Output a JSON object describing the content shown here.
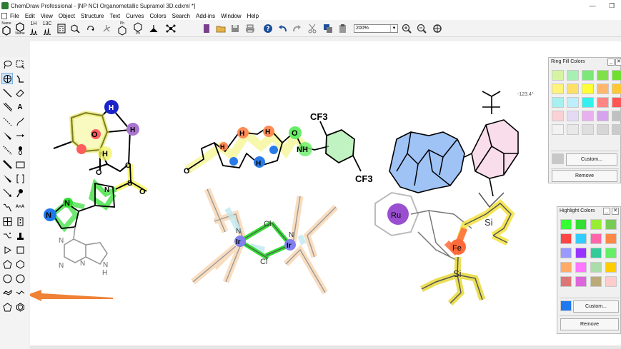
{
  "window": {
    "title": "ChemDraw Professional - [NP NCI Organometallic Supramol 3D.cdxml *]",
    "minimize_glyph": "—",
    "maximize_glyph": "❐"
  },
  "menu": [
    "File",
    "Edit",
    "View",
    "Object",
    "Structure",
    "Text",
    "Curves",
    "Colors",
    "Search",
    "Add-ins",
    "Window",
    "Help"
  ],
  "toolbar": {
    "structure_to_name_label": "Name",
    "name_to_structure_label": "Name",
    "c13_label": "13C",
    "h1_label": "1H",
    "ph_label_1": "Ph",
    "ph_label_2": "Ph",
    "zoom_value": "200%"
  },
  "tools": {
    "text_tool_label": "A",
    "style_label": "A+A"
  },
  "canvas": {
    "angle_readout": "-123.4°",
    "atom_labels": {
      "cf3_top": "CF3",
      "cf3_bottom": "CF3",
      "nh": "NH",
      "o_imide": "O",
      "o_amide": "O",
      "o_ketone": "O",
      "o_ring": "O",
      "o_sulfone_1": "O",
      "o_sulfone_2": "O",
      "s": "S",
      "n_azet": "N",
      "n_pyrazole_1": "N",
      "n_pyrazole_2": "N",
      "n_pyr_1": "N",
      "n_pyr_2": "N",
      "n_pyr_3": "N",
      "nh_pyrrole": "H",
      "n_pyrrole": "N",
      "h1": "H",
      "h2": "H",
      "h3": "H",
      "h4": "H",
      "h5": "H",
      "h6": "H",
      "h7": "H",
      "ir_1": "Ir",
      "ir_2": "Ir",
      "cl_1": "Cl",
      "cl_2": "Cl",
      "n_ir1": "N",
      "n_ir2": "N",
      "ru": "Ru",
      "fe": "Fe",
      "si_1": "Si",
      "si_2": "Si"
    }
  },
  "ring_fill_palette": {
    "title": "Ring Fill Colors",
    "colors": [
      "#d6f5a3",
      "#a8efb3",
      "#7de87a",
      "#7fe04a",
      "#6fe032",
      "#fff37a",
      "#ffe066",
      "#ffff33",
      "#ffb86b",
      "#ffc833",
      "#a6f1ef",
      "#bdeefb",
      "#33f0ee",
      "#ff8585",
      "#ff5555",
      "#fbd1d6",
      "#e5daf5",
      "#e8b0ef",
      "#d6a3ef",
      "#c0c0c0",
      "#f2f2f2",
      "#e8e8e8",
      "#dedede",
      "#d6d6d6",
      "#cbcbcb"
    ],
    "custom_swatch": "#c8c8c8",
    "custom_label": "Custom...",
    "remove_label": "Remove"
  },
  "highlight_palette": {
    "title": "Highlight Colors",
    "colors": [
      "#33ff33",
      "#33dd33",
      "#99ee33",
      "#77cc55",
      "#ff4444",
      "#33ccff",
      "#ff66aa",
      "#ff8844",
      "#9999ff",
      "#9933ff",
      "#33cc99",
      "#66ee66",
      "#ffaa66",
      "#ff77ff",
      "#aaddaa",
      "#ffcc00",
      "#dd7777",
      "#dd66dd",
      "#bbaa77",
      "#ffcccc"
    ],
    "custom_swatch": "#1e78f0",
    "custom_label": "Custom...",
    "remove_label": "Remove"
  }
}
